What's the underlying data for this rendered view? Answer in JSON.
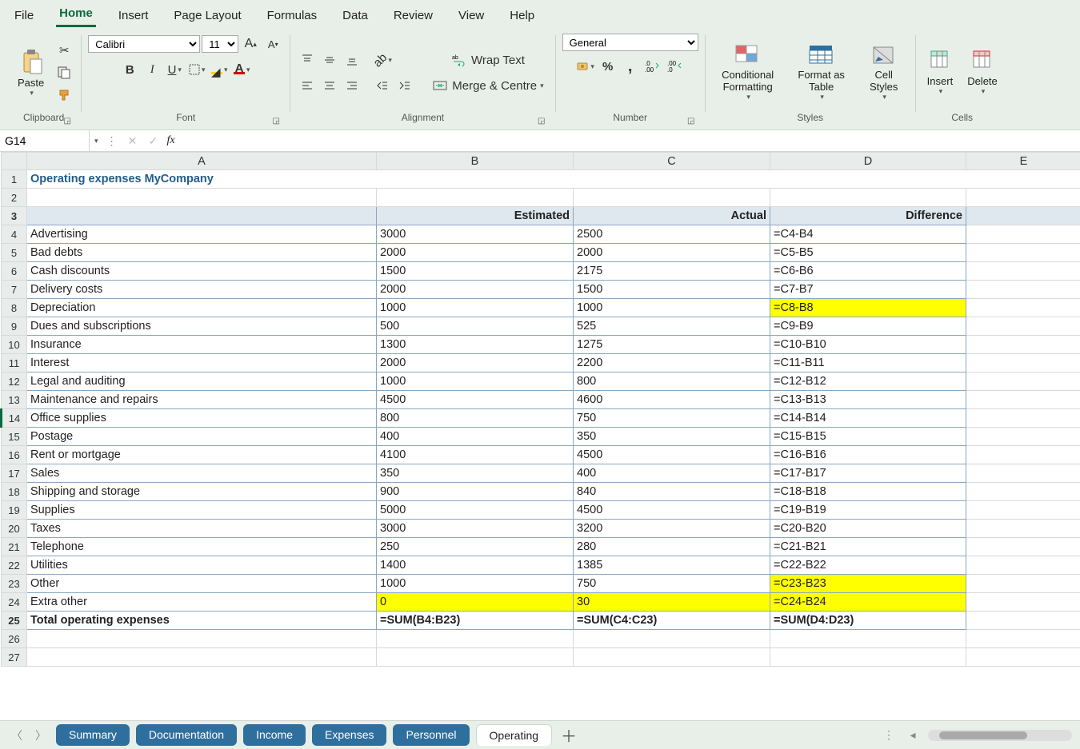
{
  "menu": {
    "items": [
      "File",
      "Home",
      "Insert",
      "Page Layout",
      "Formulas",
      "Data",
      "Review",
      "View",
      "Help"
    ],
    "active": 1
  },
  "ribbon": {
    "clipboard": {
      "paste": "Paste",
      "label": "Clipboard"
    },
    "font": {
      "name": "Calibri",
      "size": "11",
      "label": "Font"
    },
    "alignment": {
      "wrap": "Wrap Text",
      "merge": "Merge & Centre",
      "label": "Alignment"
    },
    "number": {
      "format": "General",
      "label": "Number"
    },
    "styles": {
      "cond": "Conditional Formatting",
      "fmt": "Format as Table",
      "cell": "Cell Styles",
      "label": "Styles"
    },
    "cells": {
      "insert": "Insert",
      "delete": "Delete",
      "label": "Cells"
    }
  },
  "formula_bar": {
    "name": "G14",
    "formula": ""
  },
  "columns": [
    "A",
    "B",
    "C",
    "D",
    "E"
  ],
  "sheet": {
    "title": "Operating expenses MyCompany",
    "headers": {
      "est": "Estimated",
      "act": "Actual",
      "diff": "Difference"
    },
    "rows": [
      {
        "n": 4,
        "label": "Advertising",
        "est": "3000",
        "act": "2500",
        "diff": "=C4-B4"
      },
      {
        "n": 5,
        "label": "Bad debts",
        "est": "2000",
        "act": "2000",
        "diff": "=C5-B5"
      },
      {
        "n": 6,
        "label": "Cash discounts",
        "est": "1500",
        "act": "2175",
        "diff": "=C6-B6"
      },
      {
        "n": 7,
        "label": "Delivery costs",
        "est": "2000",
        "act": "1500",
        "diff": "=C7-B7"
      },
      {
        "n": 8,
        "label": "Depreciation",
        "est": "1000",
        "act": "1000",
        "diff": "=C8-B8",
        "hl_diff": true
      },
      {
        "n": 9,
        "label": "Dues and subscriptions",
        "est": "500",
        "act": "525",
        "diff": "=C9-B9"
      },
      {
        "n": 10,
        "label": "Insurance",
        "est": "1300",
        "act": "1275",
        "diff": "=C10-B10"
      },
      {
        "n": 11,
        "label": "Interest",
        "est": "2000",
        "act": "2200",
        "diff": "=C11-B11"
      },
      {
        "n": 12,
        "label": "Legal and auditing",
        "est": "1000",
        "act": "800",
        "diff": "=C12-B12"
      },
      {
        "n": 13,
        "label": "Maintenance and repairs",
        "est": "4500",
        "act": "4600",
        "diff": "=C13-B13"
      },
      {
        "n": 14,
        "label": "Office supplies",
        "est": "800",
        "act": "750",
        "diff": "=C14-B14"
      },
      {
        "n": 15,
        "label": "Postage",
        "est": "400",
        "act": "350",
        "diff": "=C15-B15"
      },
      {
        "n": 16,
        "label": "Rent or mortgage",
        "est": "4100",
        "act": "4500",
        "diff": "=C16-B16"
      },
      {
        "n": 17,
        "label": "Sales",
        "est": "350",
        "act": "400",
        "diff": "=C17-B17"
      },
      {
        "n": 18,
        "label": "Shipping and storage",
        "est": "900",
        "act": "840",
        "diff": "=C18-B18"
      },
      {
        "n": 19,
        "label": "Supplies",
        "est": "5000",
        "act": "4500",
        "diff": "=C19-B19"
      },
      {
        "n": 20,
        "label": "Taxes",
        "est": "3000",
        "act": "3200",
        "diff": "=C20-B20"
      },
      {
        "n": 21,
        "label": "Telephone",
        "est": "250",
        "act": "280",
        "diff": "=C21-B21"
      },
      {
        "n": 22,
        "label": "Utilities",
        "est": "1400",
        "act": "1385",
        "diff": "=C22-B22"
      },
      {
        "n": 23,
        "label": "Other",
        "est": "1000",
        "act": "750",
        "diff": "=C23-B23",
        "hl_diff": true
      },
      {
        "n": 24,
        "label": "Extra other",
        "est": "0",
        "act": "30",
        "diff": "=C24-B24",
        "hl_est": true,
        "hl_act": true,
        "hl_diff": true
      }
    ],
    "total": {
      "n": 25,
      "label": "Total operating expenses",
      "est": "=SUM(B4:B23)",
      "act": "=SUM(C4:C23)",
      "diff": "=SUM(D4:D23)"
    },
    "blank_rows": [
      26,
      27
    ]
  },
  "tabs": {
    "items": [
      "Summary",
      "Documentation",
      "Income",
      "Expenses",
      "Personnel",
      "Operating"
    ],
    "active": 5
  }
}
